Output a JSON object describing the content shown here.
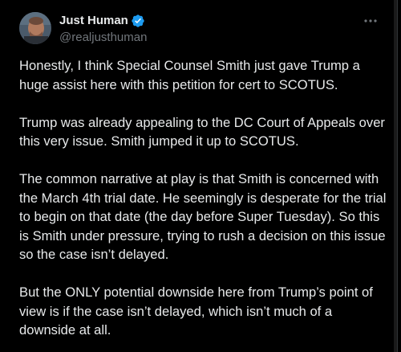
{
  "author": {
    "display_name": "Just Human",
    "handle": "@realjusthuman",
    "verified": true
  },
  "colors": {
    "background": "#000000",
    "text": "#e7e9ea",
    "muted": "#71767b",
    "verified": "#1d9bf0"
  },
  "icons": {
    "verified": "verified-badge-icon",
    "more": "more-options-icon"
  },
  "tweet": {
    "paragraphs": [
      "Honestly, I think Special Counsel Smith just gave Trump a huge assist here with this petition for cert to SCOTUS.",
      "Trump was already appealing to the DC Court of Appeals over this very issue. Smith jumped it up to SCOTUS.",
      "The common narrative at play is that Smith is concerned with the March 4th trial date. He seemingly is desperate for the trial to begin on that date (the day before Super Tuesday). So this is Smith under pressure, trying to rush a decision on this issue so the case isn’t delayed.",
      "But the ONLY potential downside here from Trump’s point of view is if the case isn’t delayed, which isn’t much of a downside at all."
    ]
  }
}
